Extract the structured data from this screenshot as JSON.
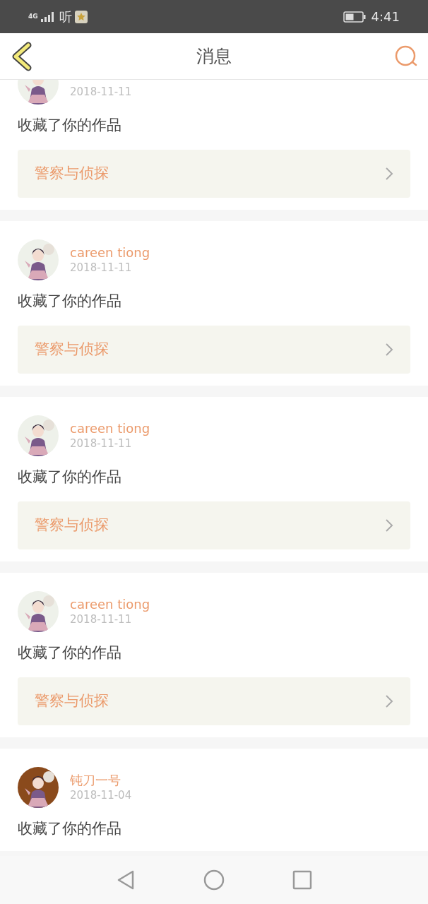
{
  "status_bar": {
    "network": "4G",
    "notification": "听",
    "time": "4:41"
  },
  "header": {
    "title": "消息"
  },
  "messages": [
    {
      "date": "2018-11-11",
      "action": "收藏了你的作品",
      "work": "警察与侦探"
    },
    {
      "name": "careen tiong",
      "date": "2018-11-11",
      "action": "收藏了你的作品",
      "work": "警察与侦探"
    },
    {
      "name": "careen tiong",
      "date": "2018-11-11",
      "action": "收藏了你的作品",
      "work": "警察与侦探"
    },
    {
      "name": "careen tiong",
      "date": "2018-11-11",
      "action": "收藏了你的作品",
      "work": "警察与侦探"
    },
    {
      "name": "钝刀一号",
      "date": "2018-11-04",
      "action": "收藏了你的作品"
    }
  ]
}
